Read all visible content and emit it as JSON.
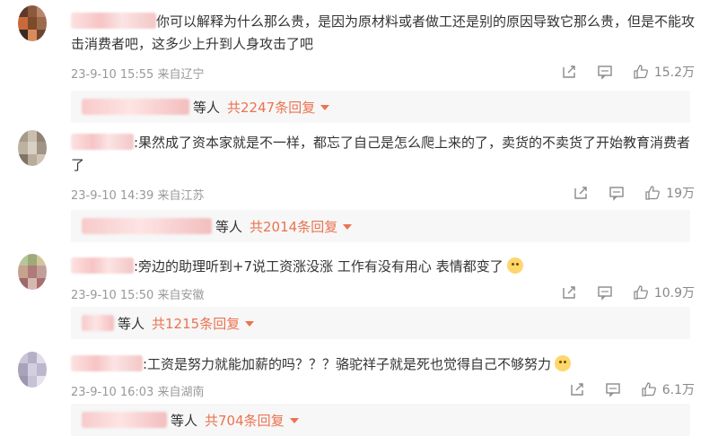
{
  "comments": [
    {
      "text": "你可以解释为什么那么贵，是因为原材料或者做工还是别的原因导致它那么贵，但是不能攻击消费者吧，这多少上升到人身攻击了吧",
      "time": "23-9-10 15:55",
      "location": "来自辽宁",
      "likes": "15.2万",
      "reply_suffix": "等人",
      "reply_count": "共2247条回复",
      "avatar_colors": [
        "#5d3a2b",
        "#8b5a3c",
        "#b8856a",
        "#c86a3a",
        "#7b4b2a",
        "#9c6b4b",
        "#3b2a22",
        "#d98c5a",
        "#6e4532"
      ]
    },
    {
      "text": ":果然成了资本家就是不一样，都忘了自己是怎么爬上来的了，卖货的不卖货了开始教育消费者了",
      "time": "23-9-10 14:39",
      "location": "来自江苏",
      "likes": "19万",
      "reply_suffix": "等人",
      "reply_count": "共2014条回复",
      "avatar_colors": [
        "#a59a8c",
        "#c9beb0",
        "#8e8375",
        "#bdb2a2",
        "#d9cfc2",
        "#9f9486",
        "#7f7466",
        "#b8ad9d",
        "#cfc4b5"
      ]
    },
    {
      "text": ":旁边的助理听到+7说工资涨没涨 工作有没有用心 表情都变了",
      "time": "23-9-10 15:50",
      "location": "来自安徽",
      "likes": "10.9万",
      "reply_suffix": "等人",
      "reply_count": "共1215条回复",
      "avatar_colors": [
        "#b9c49a",
        "#9cab78",
        "#d4c49a",
        "#c6a38c",
        "#b07a7a",
        "#c2a09a",
        "#9b6b6b",
        "#d7b8b0",
        "#a86e6e"
      ]
    },
    {
      "text": ":工资是努力就能加薪的吗？？？骆驼祥子就是死也觉得自己不够努力",
      "time": "23-9-10 16:03",
      "location": "来自湖南",
      "likes": "6.1万",
      "reply_suffix": "等人",
      "reply_count": "共704条回复",
      "avatar_colors": [
        "#c9c6d6",
        "#b5b0c7",
        "#e0dcea",
        "#a8a2bb",
        "#d3cfe0",
        "#bcb7cc",
        "#9d97b1",
        "#c7c2d6",
        "#e6e3ee"
      ]
    }
  ],
  "icons": [
    "share-icon",
    "comment-icon",
    "like-icon"
  ],
  "colors": {
    "accent": "#eb7350",
    "meta": "#999999",
    "text": "#333333"
  }
}
